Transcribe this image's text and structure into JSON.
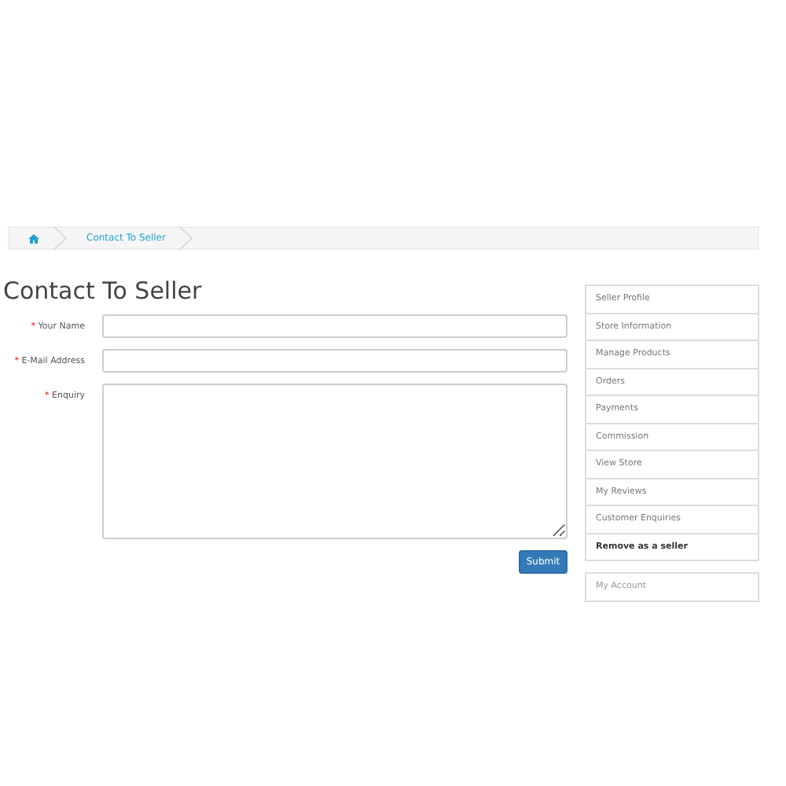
{
  "breadcrumb": [
    {
      "kind": "home"
    },
    {
      "kind": "link",
      "label": "Contact To Seller"
    }
  ],
  "title": "Contact To Seller",
  "form": {
    "fields": [
      {
        "required_mark": "*",
        "label": "Your Name",
        "kind": "text"
      },
      {
        "required_mark": "*",
        "label": "E-Mail Address",
        "kind": "text"
      },
      {
        "required_mark": "*",
        "label": "Enquiry",
        "kind": "textarea"
      }
    ],
    "submit": "Submit"
  },
  "sidebar": {
    "items": [
      {
        "label": "Seller Profile",
        "bold": false
      },
      {
        "label": "Store Information",
        "bold": false
      },
      {
        "label": "Manage Products",
        "bold": false
      },
      {
        "label": "Orders",
        "bold": false
      },
      {
        "label": "Payments",
        "bold": false
      },
      {
        "label": "Commission",
        "bold": false
      },
      {
        "label": "View Store",
        "bold": false
      },
      {
        "label": "My Reviews",
        "bold": false
      },
      {
        "label": "Customer Enquiries",
        "bold": false
      },
      {
        "label": "Remove as a seller",
        "bold": true
      }
    ]
  },
  "account": {
    "items": [
      {
        "label": "My Account"
      }
    ]
  }
}
